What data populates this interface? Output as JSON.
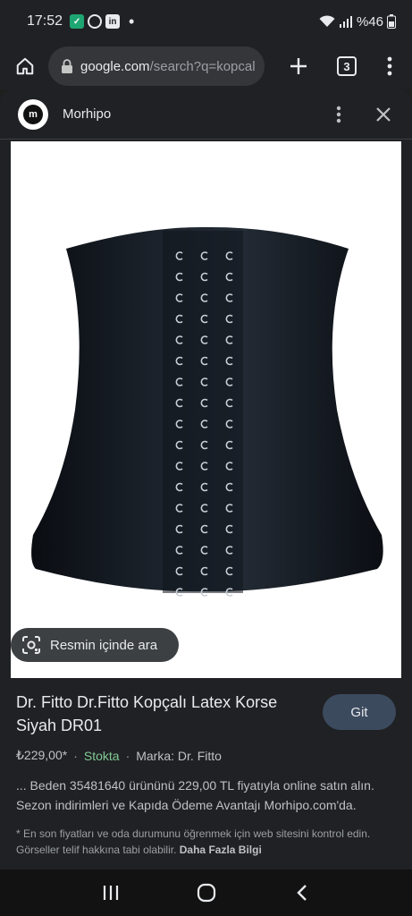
{
  "status": {
    "time": "17:52",
    "battery": "%46"
  },
  "browser": {
    "url_host": "google.com",
    "url_path": "/search?q=kopcal",
    "tab_count": "3"
  },
  "sheet": {
    "site_name": "Morhipo",
    "logo_letter": "m",
    "lens_label": "Resmin içinde ara"
  },
  "product": {
    "title": "Dr. Fitto Dr.Fitto Kopçalı Latex Korse Siyah DR01",
    "go_label": "Git",
    "price": "₺229,00*",
    "stock": "Stokta",
    "brand": "Marka: Dr. Fitto",
    "description": "... Beden 35481640 ürününü 229,00 TL fiyatıyla online satın alın. Sezon indirimleri ve Kapıda Ödeme Avantajı Morhipo.com'da.",
    "note": "* En son fiyatları ve oda durumunu öğrenmek için web sitesini kontrol edin. Görseller telif hakkına tabi olabilir.",
    "note_link": "Daha Fazla Bilgi"
  },
  "colors": {
    "background": "#202124",
    "stock_green": "#81c995",
    "button_blue": "#3c4a5e"
  },
  "icons": [
    "home-icon",
    "lock-icon",
    "plus-icon",
    "tabs-icon",
    "more-vert-icon",
    "close-icon",
    "lens-icon",
    "recents-icon",
    "home-circle-icon",
    "back-icon"
  ]
}
